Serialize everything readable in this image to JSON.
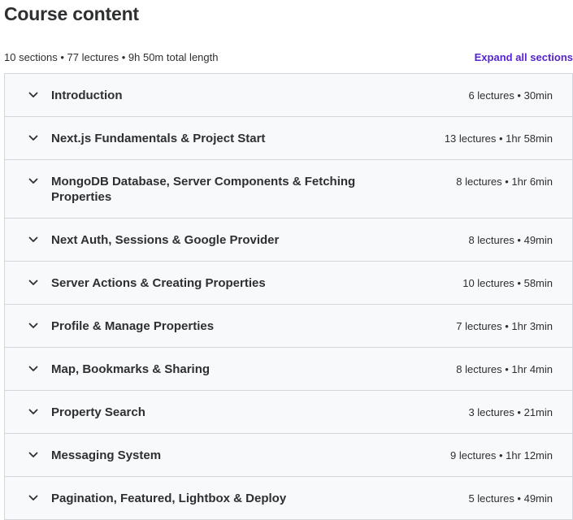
{
  "header": {
    "title": "Course content",
    "summary": "10 sections • 77 lectures • 9h 50m total length",
    "expand_all": "Expand all sections"
  },
  "colors": {
    "accent": "#5624d0",
    "section_bg": "#f7f9fa",
    "border": "#d1d7dc",
    "text": "#2d2f31"
  },
  "sections": [
    {
      "title": "Introduction",
      "meta": "6 lectures • 30min",
      "icon": "chevron-down-icon"
    },
    {
      "title": "Next.js Fundamentals & Project Start",
      "meta": "13 lectures • 1hr 58min",
      "icon": "chevron-down-icon"
    },
    {
      "title": "MongoDB Database, Server Components & Fetching Properties",
      "meta": "8 lectures • 1hr 6min",
      "icon": "chevron-down-icon"
    },
    {
      "title": "Next Auth, Sessions & Google Provider",
      "meta": "8 lectures • 49min",
      "icon": "chevron-down-icon"
    },
    {
      "title": "Server Actions & Creating Properties",
      "meta": "10 lectures • 58min",
      "icon": "chevron-down-icon"
    },
    {
      "title": "Profile & Manage Properties",
      "meta": "7 lectures • 1hr 3min",
      "icon": "chevron-down-icon"
    },
    {
      "title": "Map, Bookmarks & Sharing",
      "meta": "8 lectures • 1hr 4min",
      "icon": "chevron-down-icon"
    },
    {
      "title": "Property Search",
      "meta": "3 lectures • 21min",
      "icon": "chevron-down-icon"
    },
    {
      "title": "Messaging System",
      "meta": "9 lectures • 1hr 12min",
      "icon": "chevron-down-icon"
    },
    {
      "title": "Pagination, Featured, Lightbox & Deploy",
      "meta": "5 lectures • 49min",
      "icon": "chevron-down-icon"
    }
  ]
}
